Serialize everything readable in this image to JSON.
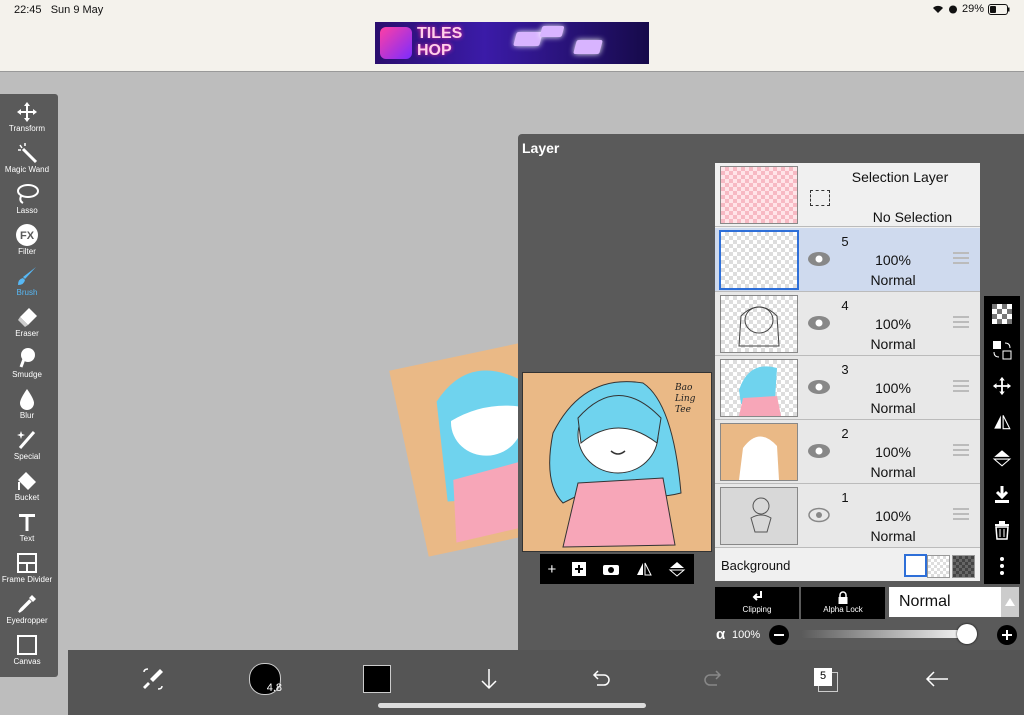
{
  "status": {
    "time": "22:45",
    "date": "Sun 9 May",
    "battery": "29%"
  },
  "ad": {
    "brand_line1": "TILES",
    "brand_line2": "HOP"
  },
  "toolbar": {
    "items": [
      "Transform",
      "Magic Wand",
      "Lasso",
      "Filter",
      "Brush",
      "Eraser",
      "Smudge",
      "Blur",
      "Special",
      "Bucket",
      "Text",
      "Frame Divider",
      "Eyedropper",
      "Canvas"
    ],
    "active": "Brush"
  },
  "layer_panel": {
    "title": "Layer",
    "selection_layer": {
      "title": "Selection Layer",
      "subtitle": "No Selection"
    },
    "layers": [
      {
        "num": "5",
        "opacity": "100%",
        "mode": "Normal",
        "selected": true
      },
      {
        "num": "4",
        "opacity": "100%",
        "mode": "Normal",
        "selected": false
      },
      {
        "num": "3",
        "opacity": "100%",
        "mode": "Normal",
        "selected": false
      },
      {
        "num": "2",
        "opacity": "100%",
        "mode": "Normal",
        "selected": false
      },
      {
        "num": "1",
        "opacity": "100%",
        "mode": "Normal",
        "selected": false
      }
    ],
    "background_label": "Background",
    "clipping_label": "Clipping",
    "alpha_lock_label": "Alpha Lock",
    "blend_mode": "Normal",
    "alpha_symbol": "α",
    "alpha_value": "100%",
    "alpha_fraction": 1.0,
    "artwork_signature": "Bao Ling Tee"
  },
  "bottombar": {
    "brush_size": "4.8",
    "layer_count": "5"
  },
  "colors": {
    "accent": "#57b8f5",
    "selected_layer": "#cfdaee",
    "selected_border": "#2e6fd8",
    "panel": "#5a5a5a",
    "art_bg": "#eab986",
    "hair": "#6fd3ee",
    "dress": "#f7a6b8"
  }
}
